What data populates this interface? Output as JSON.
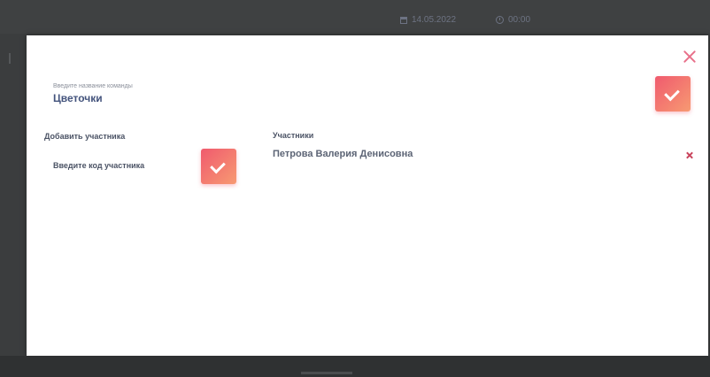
{
  "header": {
    "date": "14.05.2022",
    "time": "00:00"
  },
  "team": {
    "caption": "Введите название команды",
    "name": "Цветочки"
  },
  "add_member": {
    "heading": "Добавить участника",
    "input_placeholder": "Введите код участника"
  },
  "members": {
    "heading": "Участники",
    "items": [
      {
        "name": "Петрова Валерия Денисовна"
      }
    ]
  },
  "colors": {
    "accent_start": "#f05a6e",
    "accent_end": "#f79a72",
    "close": "#e8708a",
    "remove": "#c9435c",
    "team_name": "#43537c"
  }
}
